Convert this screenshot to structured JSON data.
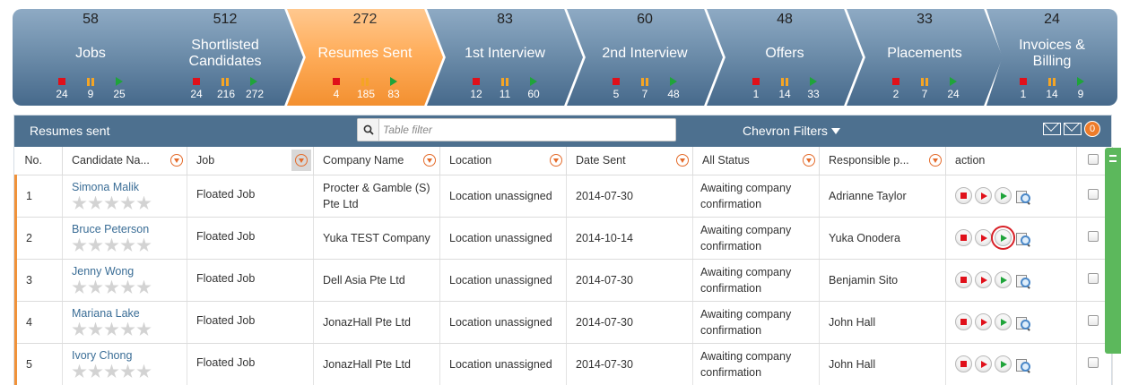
{
  "pipeline": [
    {
      "count": "58",
      "label": "Jobs",
      "red": "24",
      "yellow": "9",
      "green": "25",
      "active": false
    },
    {
      "count": "512",
      "label": "Shortlisted Candidates",
      "red": "24",
      "yellow": "216",
      "green": "272",
      "active": false
    },
    {
      "count": "272",
      "label": "Resumes Sent",
      "red": "4",
      "yellow": "185",
      "green": "83",
      "active": true
    },
    {
      "count": "83",
      "label": "1st Interview",
      "red": "12",
      "yellow": "11",
      "green": "60",
      "active": false
    },
    {
      "count": "60",
      "label": "2nd Interview",
      "red": "5",
      "yellow": "7",
      "green": "48",
      "active": false
    },
    {
      "count": "48",
      "label": "Offers",
      "red": "1",
      "yellow": "14",
      "green": "33",
      "active": false
    },
    {
      "count": "33",
      "label": "Placements",
      "red": "2",
      "yellow": "7",
      "green": "24",
      "active": false
    },
    {
      "count": "24",
      "label": "Invoices & Billing",
      "red": "1",
      "yellow": "14",
      "green": "9",
      "active": false
    }
  ],
  "panel": {
    "title": "Resumes sent",
    "filter_placeholder": "Table filter",
    "chevron_filters": "Chevron Filters",
    "badge_count": "0"
  },
  "table": {
    "columns": [
      "No.",
      "Candidate Na...",
      "Job",
      "Company Name",
      "Location",
      "Date Sent",
      "All Status",
      "Responsible p...",
      "action"
    ],
    "rows": [
      {
        "no": "1",
        "name": "Simona Malik",
        "job": "Floated Job",
        "company": "Procter & Gamble (S) Pte Ltd",
        "location": "Location unassigned",
        "date": "2014-07-30",
        "status": "Awaiting company confirmation",
        "responsible": "Adrianne Taylor"
      },
      {
        "no": "2",
        "name": "Bruce Peterson",
        "job": "Floated Job",
        "company": "Yuka TEST Company",
        "location": "Location unassigned",
        "date": "2014-10-14",
        "status": "Awaiting company confirmation",
        "responsible": "Yuka Onodera"
      },
      {
        "no": "3",
        "name": "Jenny Wong",
        "job": "Floated Job",
        "company": "Dell Asia Pte Ltd",
        "location": "Location unassigned",
        "date": "2014-07-30",
        "status": "Awaiting company confirmation",
        "responsible": "Benjamin Sito"
      },
      {
        "no": "4",
        "name": "Mariana Lake",
        "job": "Floated Job",
        "company": "JonazHall Pte Ltd",
        "location": "Location unassigned",
        "date": "2014-07-30",
        "status": "Awaiting company confirmation",
        "responsible": "John Hall"
      },
      {
        "no": "5",
        "name": "Ivory Chong",
        "job": "Floated Job",
        "company": "JonazHall Pte Ltd",
        "location": "Location unassigned",
        "date": "2014-07-30",
        "status": "Awaiting company confirmation",
        "responsible": "John Hall"
      }
    ]
  },
  "colors": {
    "chevron_blue": "#6e8eab",
    "chevron_active": "#ffae5c",
    "header_bar": "#4d708f",
    "row_accent": "#f0923a",
    "highlight": "#d81f26"
  }
}
